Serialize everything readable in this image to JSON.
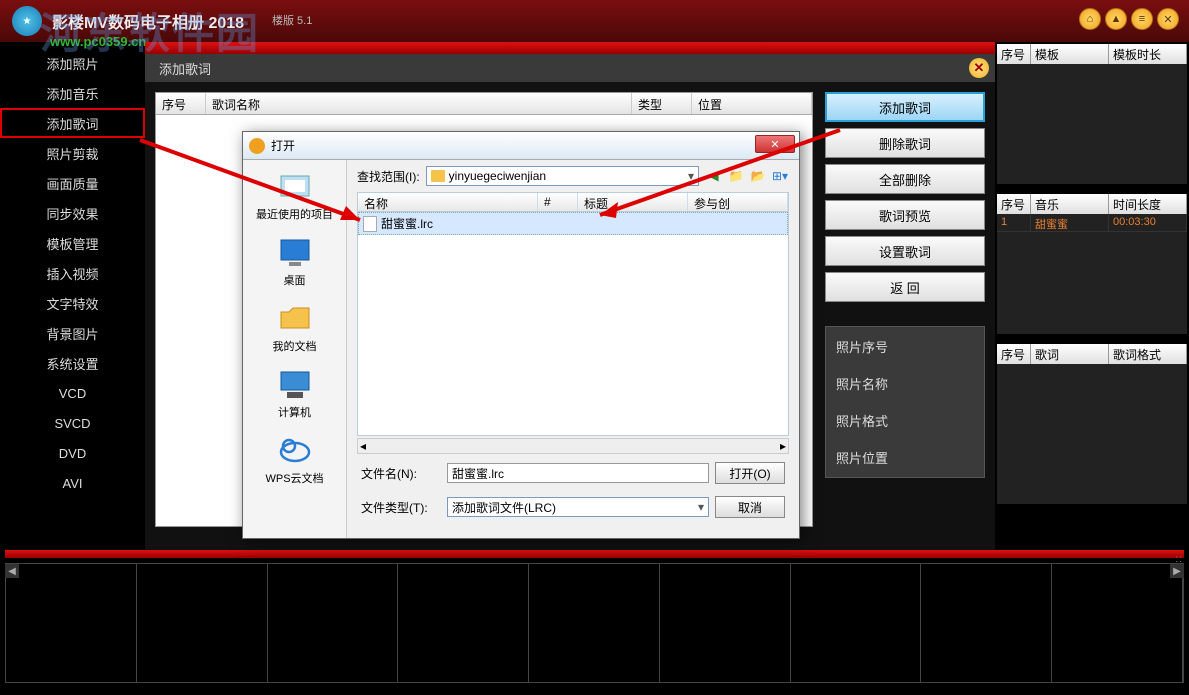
{
  "app": {
    "title": "影楼MV数码电子相册 2018",
    "version": "楼版 5.1",
    "watermark_url": "www.pc0359.cn",
    "watermark_big": "河东软件园"
  },
  "titlebar_buttons": [
    "home",
    "up",
    "menu",
    "close"
  ],
  "sidebar": {
    "items": [
      {
        "label": "添加照片"
      },
      {
        "label": "添加音乐"
      },
      {
        "label": "添加歌词",
        "selected": true
      },
      {
        "label": "照片剪裁"
      },
      {
        "label": "画面质量"
      },
      {
        "label": "同步效果"
      },
      {
        "label": "模板管理"
      },
      {
        "label": "插入视频"
      },
      {
        "label": "文字特效"
      },
      {
        "label": "背景图片"
      },
      {
        "label": "系统设置"
      },
      {
        "label": "VCD"
      },
      {
        "label": "SVCD"
      },
      {
        "label": "DVD"
      },
      {
        "label": "AVI"
      }
    ]
  },
  "tab": {
    "title": "添加歌词"
  },
  "list_headers": {
    "c1": "序号",
    "c2": "歌词名称",
    "c3": "类型",
    "c4": "位置"
  },
  "actions": {
    "add": "添加歌词",
    "delete": "删除歌词",
    "delete_all": "全部删除",
    "preview": "歌词预览",
    "set": "设置歌词",
    "back": "返   回"
  },
  "info_panel": {
    "photo_seq": "照片序号",
    "photo_name": "照片名称",
    "photo_format": "照片格式",
    "photo_pos": "照片位置"
  },
  "right_tables": {
    "t1": {
      "h1": "序号",
      "h2": "模板",
      "h3": "模板时长"
    },
    "t2": {
      "h1": "序号",
      "h2": "音乐",
      "h3": "时间长度",
      "row": {
        "no": "1",
        "name": "甜蜜蜜",
        "dur": "00:03:30"
      }
    },
    "t3": {
      "h1": "序号",
      "h2": "歌词",
      "h3": "歌词格式"
    }
  },
  "dialog": {
    "title": "打开",
    "lookin_label": "查找范围(I):",
    "folder": "yinyuegeciwenjian",
    "places": {
      "recent": "最近使用的项目",
      "desktop": "桌面",
      "documents": "我的文档",
      "computer": "计算机",
      "wps": "WPS云文档"
    },
    "columns": {
      "name": "名称",
      "num": "#",
      "title": "标题",
      "artists": "参与创"
    },
    "file": "甜蜜蜜.lrc",
    "filename_label": "文件名(N):",
    "filename_value": "甜蜜蜜.lrc",
    "filetype_label": "文件类型(T):",
    "filetype_value": "添加歌词文件(LRC)",
    "open": "打开(O)",
    "cancel": "取消"
  }
}
